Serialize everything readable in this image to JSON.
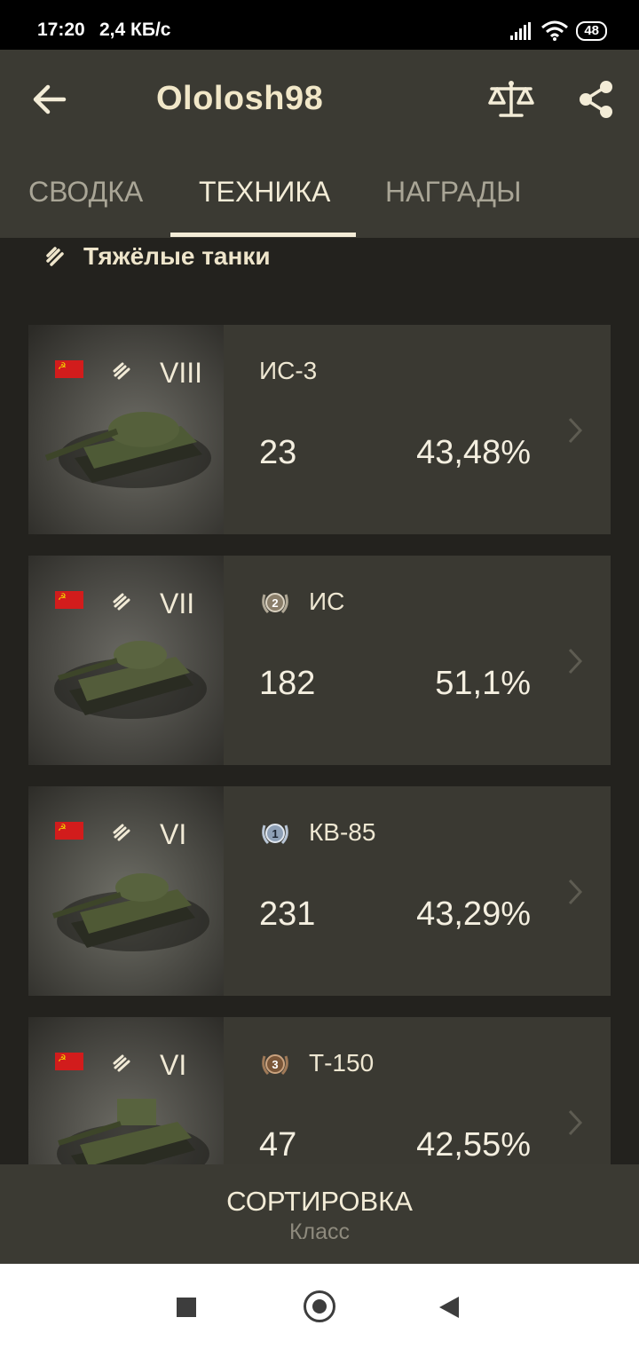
{
  "status_bar": {
    "time": "17:20",
    "speed": "2,4 КБ/с",
    "battery": "48"
  },
  "app_bar": {
    "title": "Ololosh98",
    "back_icon": "arrow-left-icon",
    "compare_icon": "scales-icon",
    "share_icon": "share-icon"
  },
  "tabs": [
    {
      "label": "СВОДКА",
      "active": false
    },
    {
      "label": "ТЕХНИКА",
      "active": true
    },
    {
      "label": "НАГРАДЫ",
      "active": false
    }
  ],
  "section": {
    "title": "Тяжёлые танки",
    "icon": "heavy-tank-class-icon"
  },
  "vehicles": [
    {
      "nation": "ussr",
      "tier": "VIII",
      "name": "ИС-3",
      "mastery": "",
      "battles": "23",
      "winrate": "43,48%"
    },
    {
      "nation": "ussr",
      "tier": "VII",
      "name": "ИС",
      "mastery": "2",
      "battles": "182",
      "winrate": "51,1%"
    },
    {
      "nation": "ussr",
      "tier": "VI",
      "name": "КВ-85",
      "mastery": "1",
      "battles": "231",
      "winrate": "43,29%"
    },
    {
      "nation": "ussr",
      "tier": "VI",
      "name": "Т-150",
      "mastery": "3",
      "battles": "47",
      "winrate": "42,55%"
    }
  ],
  "sort": {
    "title": "СОРТИРОВКА",
    "value": "Класс"
  },
  "colors": {
    "app_bar": "#3b3a33",
    "background": "#23221e",
    "card": "#3a3932",
    "accent_text": "#f1e7c8",
    "flag_red": "#d21c1c"
  }
}
